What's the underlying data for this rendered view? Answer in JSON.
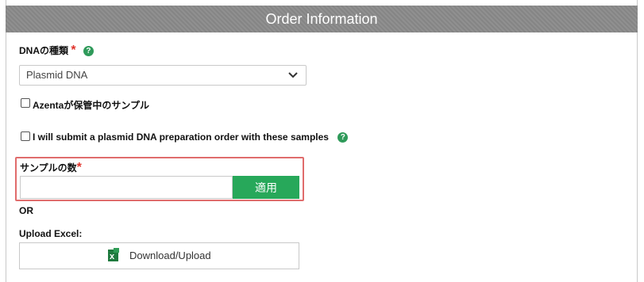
{
  "header": {
    "title": "Order Information"
  },
  "dna_type": {
    "label": "DNAの種類",
    "required_mark": "*",
    "help_glyph": "?",
    "selected": "Plasmid DNA"
  },
  "checkbox_azenta": {
    "label": "Azentaが保管中のサンプル",
    "checked": false
  },
  "checkbox_plasmid_prep": {
    "label": "I will submit a plasmid DNA preparation order with these samples",
    "checked": false,
    "help_glyph": "?"
  },
  "sample_count": {
    "label": "サンプルの数",
    "required_mark": "*",
    "value": "",
    "apply_label": "適用"
  },
  "or_text": "OR",
  "upload": {
    "label": "Upload Excel:",
    "button_label": "Download/Upload",
    "icon": "excel-icon"
  },
  "colors": {
    "header_bg": "#8a8a8a",
    "accent_green": "#27a85a",
    "required_red": "#e0332b",
    "highlight_border": "#e06c6c"
  }
}
